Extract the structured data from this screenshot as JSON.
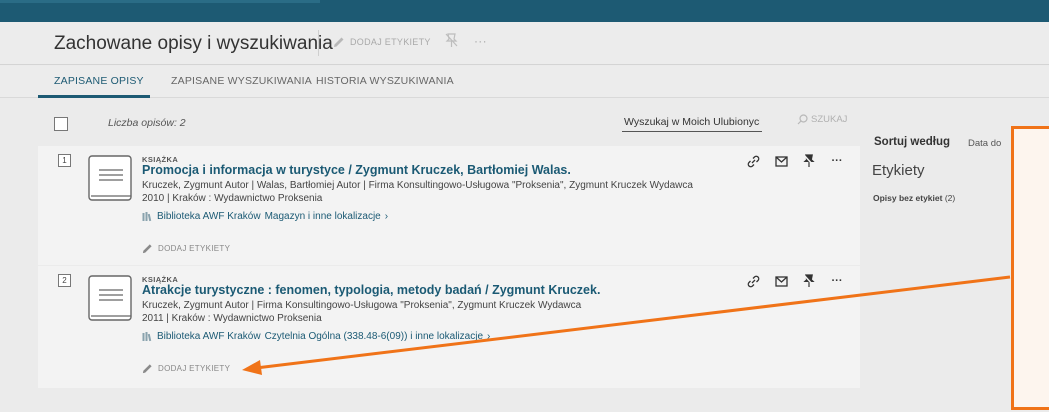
{
  "header": {
    "page_title": "Zachowane opisy i wyszukiwania",
    "add_labels": "DODAJ ETYKIETY",
    "more": "···"
  },
  "tabs": [
    {
      "label": "ZAPISANE OPISY",
      "active": true
    },
    {
      "label": "ZAPISANE WYSZUKIWANIA",
      "active": false
    },
    {
      "label": "HISTORIA WYSZUKIWANIA",
      "active": false
    }
  ],
  "list": {
    "count_label": "Liczba opisów: 2",
    "search_value": "Wyszukaj w Moich Ulubionych",
    "search_button": "SZUKAJ"
  },
  "records": [
    {
      "number": "1",
      "type": "KSIĄŻKA",
      "title": "Promocja i informacja w turystyce / Zygmunt Kruczek, Bartłomiej Walas.",
      "authors": "Kruczek, Zygmunt Autor | Walas, Bartłomiej Autor | Firma Konsultingowo-Usługowa \"Proksenia\", Zygmunt Kruczek Wydawca",
      "publication": "2010 | Kraków : Wydawnictwo Proksenia",
      "library": "Biblioteka AWF Kraków",
      "location": "Magazyn i inne lokalizacje",
      "tag_label": "DODAJ ETYKIETY"
    },
    {
      "number": "2",
      "type": "KSIĄŻKA",
      "title": "Atrakcje turystyczne : fenomen, typologia, metody badań / Zygmunt Kruczek.",
      "authors": "Kruczek, Zygmunt Autor | Firma Konsultingowo-Usługowa \"Proksenia\", Zygmunt Kruczek Wydawca",
      "publication": "2011 | Kraków : Wydawnictwo Proksenia",
      "library": "Biblioteka AWF Kraków",
      "location": "Czytelnia Ogólna (338.48-6(09)) i inne lokalizacje",
      "tag_label": "DODAJ ETYKIETY"
    }
  ],
  "sidebar": {
    "sort_label": "Sortuj według",
    "sort_value": "Data do",
    "labels_title": "Etykiety",
    "untagged_label": "Opisy bez etykiet",
    "untagged_count": "(2)"
  },
  "colors": {
    "header_bg": "#1d5a73",
    "link": "#1b5a74",
    "annotation": "#f07318"
  }
}
